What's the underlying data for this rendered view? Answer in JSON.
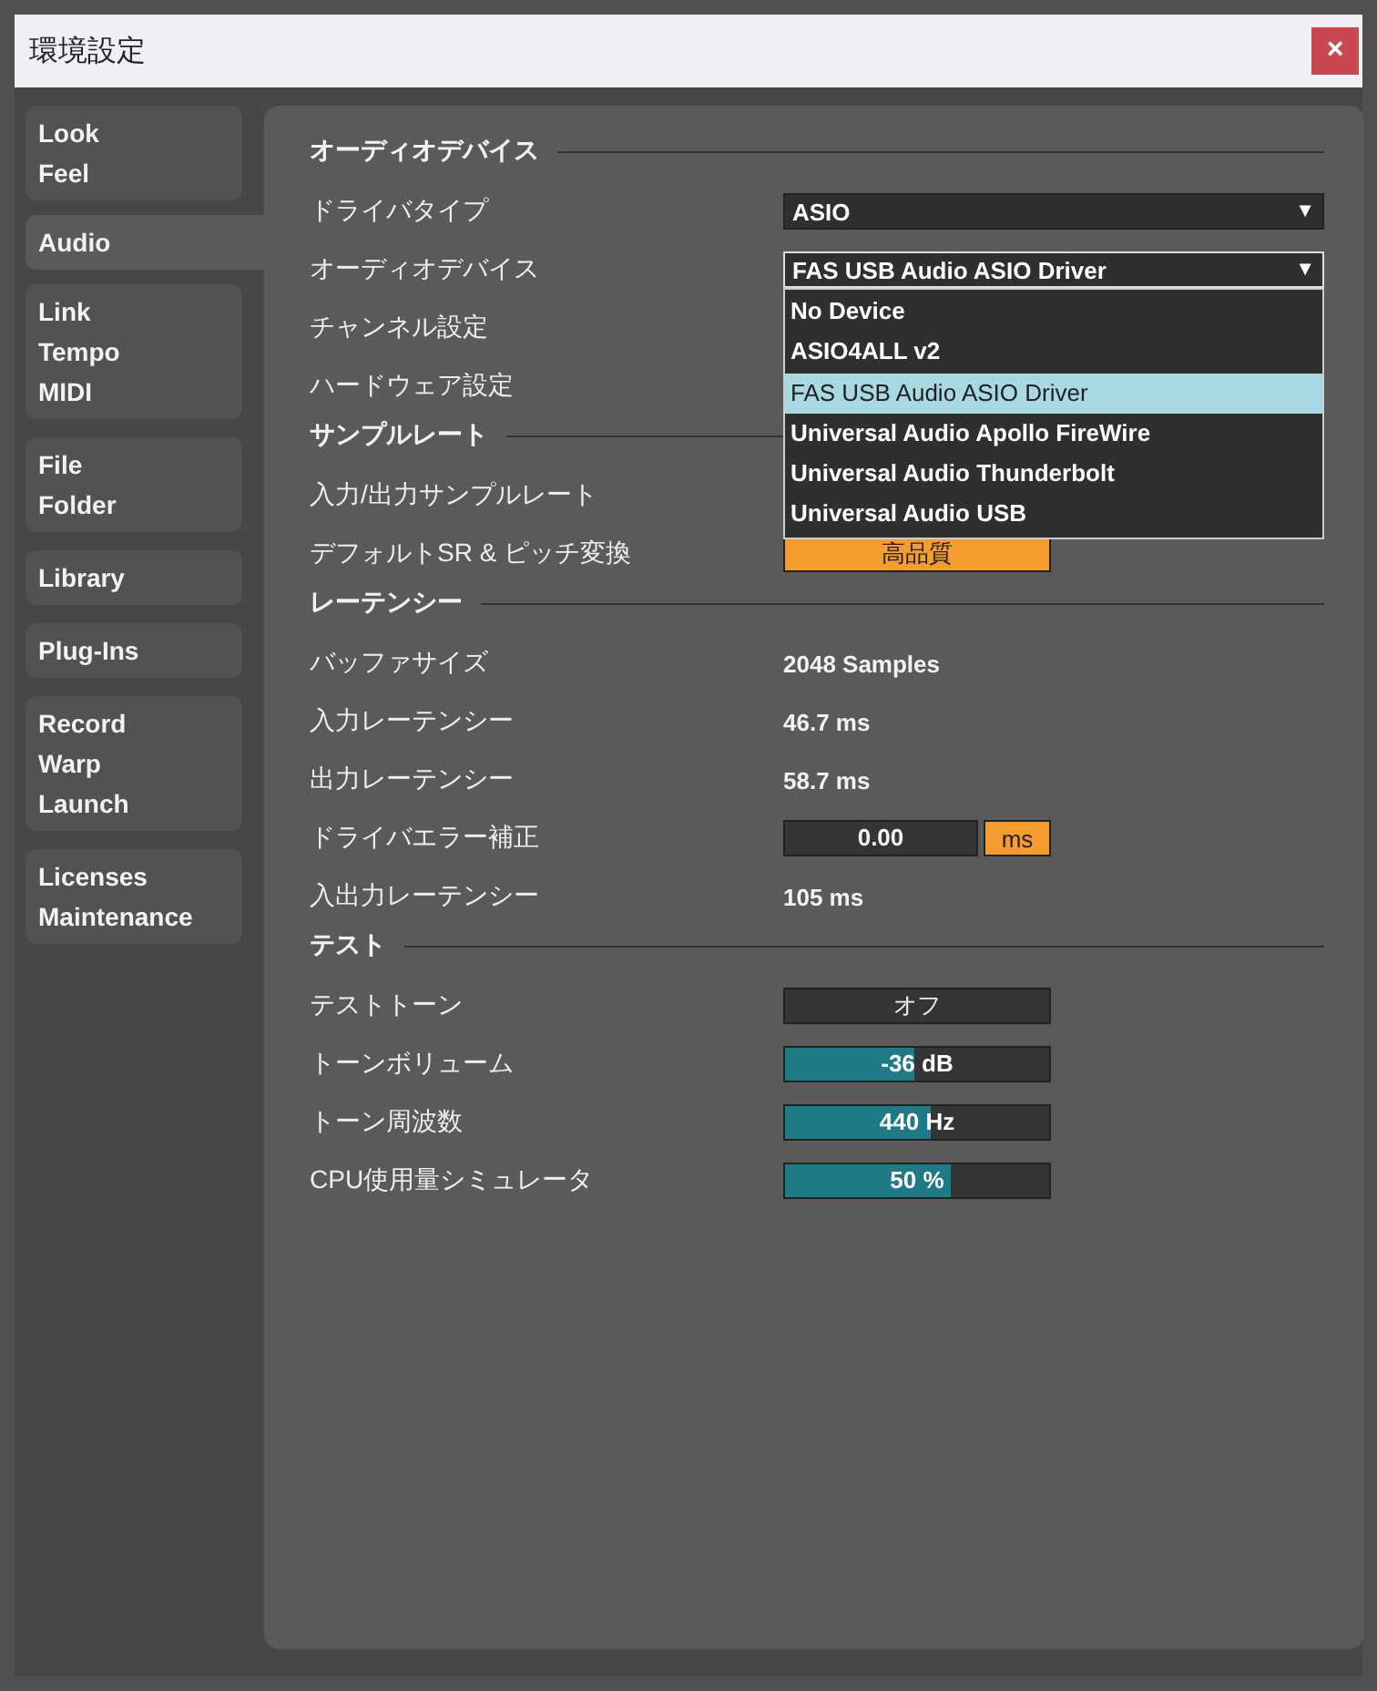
{
  "window": {
    "title": "環境設定",
    "close": "×"
  },
  "sidebar": {
    "tabs": [
      {
        "labels": [
          "Look",
          "Feel"
        ],
        "selected": false
      },
      {
        "labels": [
          "Audio"
        ],
        "selected": true
      },
      {
        "labels": [
          "Link",
          "Tempo",
          "MIDI"
        ],
        "selected": false
      },
      {
        "labels": [
          "File",
          "Folder"
        ],
        "selected": false
      },
      {
        "labels": [
          "Library"
        ],
        "selected": false
      },
      {
        "labels": [
          "Plug-Ins"
        ],
        "selected": false
      },
      {
        "labels": [
          "Record",
          "Warp",
          "Launch"
        ],
        "selected": false
      },
      {
        "labels": [
          "Licenses",
          "Maintenance"
        ],
        "selected": false
      }
    ]
  },
  "sections": [
    {
      "title": "オーディオデバイス",
      "rows": [
        {
          "label": "ドライバタイプ",
          "control": {
            "kind": "dropdown",
            "value": "ASIO",
            "arrow": "▼",
            "open": false
          }
        },
        {
          "label": "オーディオデバイス",
          "control": {
            "kind": "dropdown",
            "value": "FAS USB Audio ASIO Driver",
            "arrow": "▼",
            "open": true,
            "options": [
              {
                "label": "No Device",
                "selected": false
              },
              {
                "label": "ASIO4ALL v2",
                "selected": false
              },
              {
                "label": "FAS USB Audio ASIO Driver",
                "selected": true
              },
              {
                "label": "Universal Audio Apollo FireWire",
                "selected": false
              },
              {
                "label": "Universal Audio Thunderbolt",
                "selected": false
              },
              {
                "label": "Universal Audio USB",
                "selected": false
              }
            ]
          }
        },
        {
          "label": "チャンネル設定"
        },
        {
          "label": "ハードウェア設定"
        }
      ]
    },
    {
      "title": "サンプルレート",
      "rows": [
        {
          "label": "入力/出力サンプルレート"
        },
        {
          "label": "デフォルトSR & ピッチ変換",
          "control": {
            "kind": "toggle",
            "text": "高品質",
            "on": true
          }
        }
      ]
    },
    {
      "title": "レーテンシー",
      "rows": [
        {
          "label": "バッファサイズ",
          "control": {
            "kind": "value",
            "text": "2048 Samples"
          }
        },
        {
          "label": "入力レーテンシー",
          "control": {
            "kind": "value",
            "text": "46.7 ms"
          }
        },
        {
          "label": "出力レーテンシー",
          "control": {
            "kind": "value",
            "text": "58.7 ms"
          }
        },
        {
          "label": "ドライバエラー補正",
          "control": {
            "kind": "number",
            "value": "0.00",
            "unit": "ms",
            "unit_on": true
          }
        },
        {
          "label": "入出力レーテンシー",
          "control": {
            "kind": "value",
            "text": "105 ms"
          }
        }
      ]
    },
    {
      "title": "テスト",
      "rows": [
        {
          "label": "テストトーン",
          "control": {
            "kind": "toggle",
            "text": "オフ",
            "on": false
          }
        },
        {
          "label": "トーンボリューム",
          "control": {
            "kind": "slider",
            "text": "-36 dB",
            "level": 0.49
          }
        },
        {
          "label": "トーン周波数",
          "control": {
            "kind": "slider",
            "text": "440 Hz",
            "level": 0.55
          }
        },
        {
          "label": "CPU使用量シミュレータ",
          "control": {
            "kind": "slider",
            "text": "50 %",
            "level": 0.63
          }
        }
      ]
    }
  ]
}
